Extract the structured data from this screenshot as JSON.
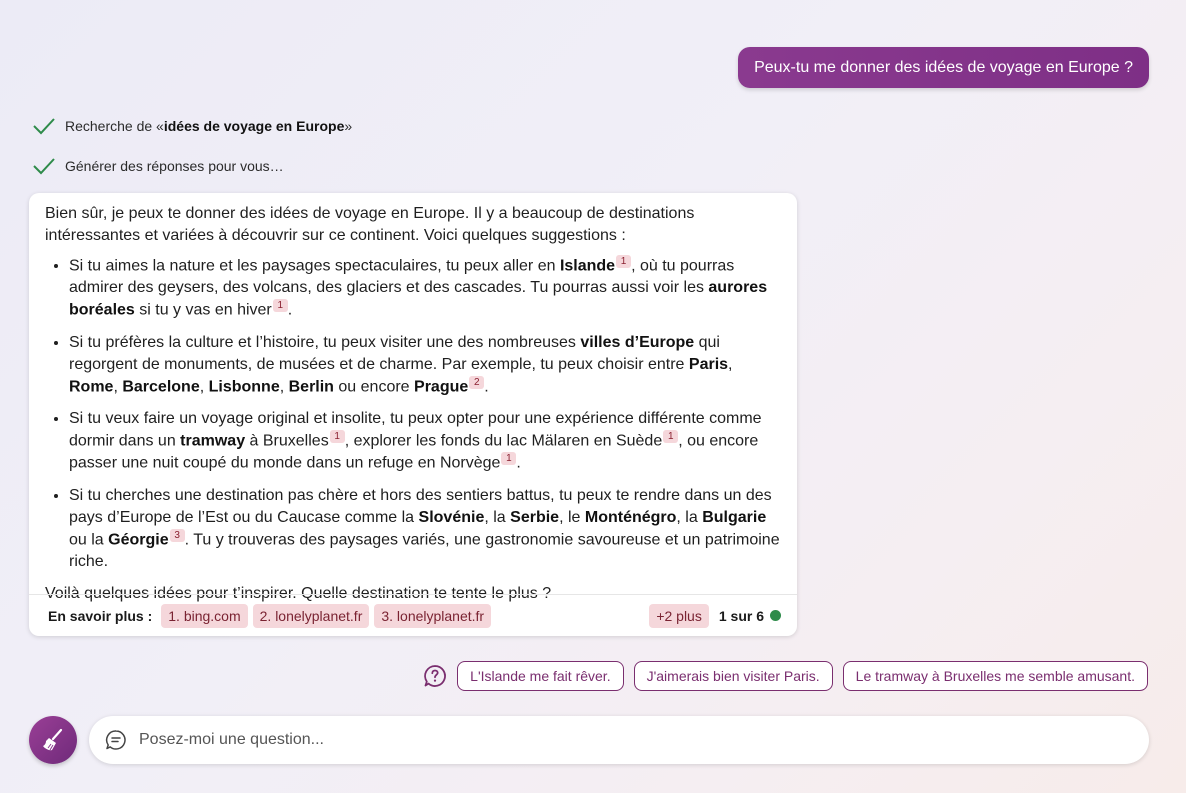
{
  "user_message": "Peux-tu me donner des idées de voyage en Europe ?",
  "status_steps": [
    {
      "prefix": "Recherche de «",
      "query": "idées de voyage en Europe",
      "suffix": "»"
    },
    {
      "text": "Générer des réponses pour vous…"
    }
  ],
  "answer": {
    "intro": "Bien sûr, je peux te donner des idées de voyage en Europe. Il y a beaucoup de destinations intéressantes et variées à découvrir sur ce continent. Voici quelques suggestions :",
    "items": [
      {
        "t1": "Si tu aimes la nature et les paysages spectaculaires, tu peux aller en ",
        "b1": "Islande",
        "c1": "1",
        "t2": ", où tu pourras admirer des geysers, des volcans, des glaciers et des cascades. Tu pourras aussi voir les ",
        "b2": "aurores boréales",
        "t3": " si tu y vas en hiver",
        "c2": "1",
        "t4": "."
      },
      {
        "t1": "Si tu préfères la culture et l’histoire, tu peux visiter une des nombreuses ",
        "b1": "villes d’Europe",
        "t2": " qui regorgent de monuments, de musées et de charme. Par exemple, tu peux choisir entre ",
        "b2": "Paris",
        "s1": ", ",
        "b3": "Rome",
        "s2": ", ",
        "b4": "Barcelone",
        "s3": ", ",
        "b5": "Lisbonne",
        "s4": ", ",
        "b6": "Berlin",
        "s5": " ou encore ",
        "b7": "Prague",
        "c1": "2",
        "t3": "."
      },
      {
        "t1": "Si tu veux faire un voyage original et insolite, tu peux opter pour une expérience différente comme dormir dans un ",
        "b1": "tramway",
        "t2": " à Bruxelles",
        "c1": "1",
        "t3": ", explorer les fonds du lac Mälaren en Suède",
        "c2": "1",
        "t4": ", ou encore passer une nuit coupé du monde dans un refuge en Norvège",
        "c3": "1",
        "t5": "."
      },
      {
        "t1": "Si tu cherches une destination pas chère et hors des sentiers battus, tu peux te rendre dans un des pays d’Europe de l’Est ou du Caucase comme la ",
        "b1": "Slovénie",
        "s1": ", la ",
        "b2": "Serbie",
        "s2": ", le ",
        "b3": "Monténégro",
        "s3": ", la ",
        "b4": "Bulgarie",
        "s4": " ou la ",
        "b5": "Géorgie",
        "c1": "3",
        "t2": ". Tu y trouveras des paysages variés, une gastronomie savoureuse et un patrimoine riche."
      }
    ],
    "outro": "Voilà quelques idées pour t’inspirer. Quelle destination te tente le plus ?"
  },
  "sources": {
    "label": "En savoir plus :",
    "links": [
      "1. bing.com",
      "2. lonelyplanet.fr",
      "3. lonelyplanet.fr"
    ],
    "more": "+2 plus",
    "counter": "1 sur 6",
    "status_color": "#2e8b4a"
  },
  "suggestions": [
    "L'Islande me fait rêver.",
    "J'aimerais bien visiter Paris.",
    "Le tramway à Bruxelles me semble amusant."
  ],
  "input": {
    "placeholder": "Posez-moi une question..."
  },
  "icons": {
    "status": "check-icon",
    "suggestions": "question-bubble-icon",
    "new_topic": "broom-icon",
    "input": "chat-bubble-icon"
  },
  "colors": {
    "accent": "#7e2f86",
    "citation_bg": "#f5d7db",
    "check": "#2e8b4a"
  }
}
